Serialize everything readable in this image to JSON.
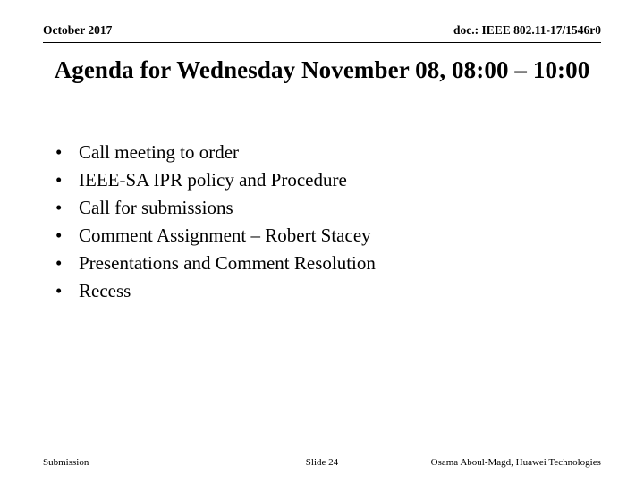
{
  "header": {
    "date": "October 2017",
    "doc_reference": "doc.: IEEE 802.11-17/1546r0"
  },
  "title": {
    "line1": "Agenda for Wednesday November 08, 08:00 –",
    "line2": "10:00"
  },
  "content": {
    "bullet_marker": "•",
    "bullets": [
      {
        "label": "Call meeting to order"
      },
      {
        "label": "IEEE-SA IPR policy and Procedure"
      },
      {
        "label": "Call for submissions"
      },
      {
        "label": "Comment Assignment – Robert Stacey"
      },
      {
        "label": "Presentations and Comment Resolution"
      },
      {
        "label": "Recess"
      }
    ]
  },
  "footer": {
    "left": "Submission",
    "center": "Slide 24",
    "right": "Osama Aboul-Magd, Huawei Technologies"
  },
  "colors": {
    "background": "#ffffff",
    "text": "#000000",
    "rule": "#000000"
  }
}
